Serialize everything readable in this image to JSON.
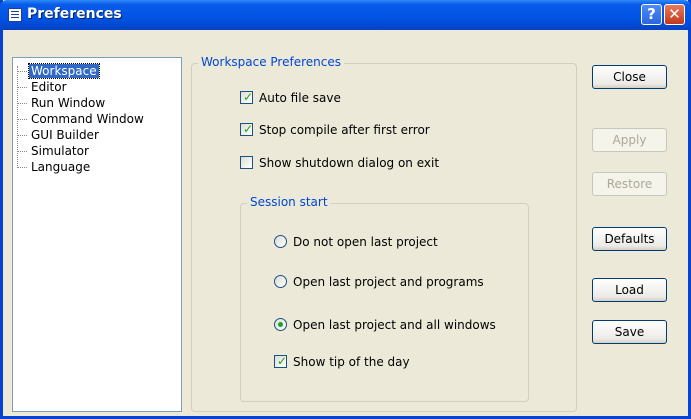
{
  "window": {
    "title": "Preferences",
    "help_glyph": "?",
    "close_glyph": "✕"
  },
  "tree": {
    "items": [
      {
        "label": "Workspace",
        "selected": true
      },
      {
        "label": "Editor"
      },
      {
        "label": "Run Window"
      },
      {
        "label": "Command Window"
      },
      {
        "label": "GUI Builder"
      },
      {
        "label": "Simulator"
      },
      {
        "label": "Language"
      }
    ]
  },
  "workspace": {
    "group_title": "Workspace Preferences",
    "auto_save": {
      "label": "Auto file save",
      "checked": true
    },
    "stop_compile": {
      "label": "Stop compile after first error",
      "checked": true
    },
    "shutdown_dialog": {
      "label": "Show shutdown dialog on exit",
      "checked": false
    },
    "session": {
      "title": "Session start",
      "options": [
        {
          "label": "Do not open last project",
          "selected": false
        },
        {
          "label": "Open last project and programs",
          "selected": false
        },
        {
          "label": "Open last project and all windows",
          "selected": true
        }
      ],
      "tip": {
        "label": "Show tip of the day",
        "checked": true
      }
    }
  },
  "buttons": {
    "close": "Close",
    "apply": "Apply",
    "restore": "Restore",
    "defaults": "Defaults",
    "load": "Load",
    "save": "Save"
  },
  "icons": {
    "check": "check-mark-icon",
    "radio": "radio-dot-icon"
  }
}
